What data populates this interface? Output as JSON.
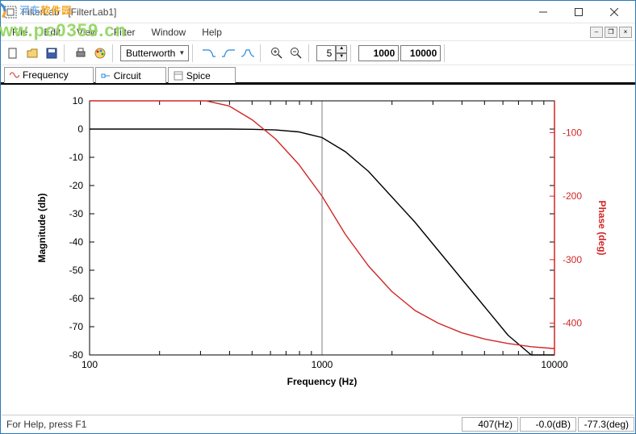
{
  "window": {
    "title": "FilterLab - [FilterLab1]"
  },
  "menu": [
    "File",
    "Edit",
    "View",
    "Filter",
    "Window",
    "Help"
  ],
  "toolbar": {
    "filter_type": "Butterworth",
    "order": "5",
    "freq1": "1000",
    "freq2": "10000"
  },
  "tabs": [
    "Frequency",
    "Circuit",
    "Spice"
  ],
  "active_tab": 0,
  "status": {
    "help": "For Help, press F1",
    "freq": "407(Hz)",
    "mag": "-0.0(dB)",
    "phase": "-77.3(deg)"
  },
  "watermark": {
    "line1a": "河东",
    "line1b": "软件园",
    "line2": "www.pc0359.cn"
  },
  "chart_data": {
    "type": "line",
    "title": "",
    "xlabel": "Frequency (Hz)",
    "ylabel_left": "Magnitude (db)",
    "ylabel_right": "Phase (deg)",
    "x": [
      100,
      126,
      158,
      200,
      251,
      316,
      398,
      501,
      631,
      794,
      1000,
      1259,
      1585,
      1995,
      2512,
      3162,
      3981,
      5012,
      6310,
      7943,
      10000
    ],
    "series": [
      {
        "name": "Magnitude",
        "axis": "left",
        "color": "#000000",
        "values": [
          0,
          0,
          0,
          0,
          0,
          0,
          0,
          -0.1,
          -0.3,
          -1,
          -3,
          -8,
          -15,
          -24,
          -33,
          -43,
          -53,
          -63,
          -73,
          -80,
          -80
        ]
      },
      {
        "name": "Phase",
        "axis": "right",
        "color": "#d22626",
        "values": [
          -5,
          -10,
          -15,
          -22,
          -30,
          -42,
          -58,
          -80,
          -110,
          -150,
          -200,
          -260,
          -310,
          -350,
          -380,
          -400,
          -415,
          -425,
          -432,
          -437,
          -440
        ]
      }
    ],
    "x_scale": "log",
    "xlim": [
      100,
      10000
    ],
    "ylim_left": [
      -80,
      10
    ],
    "ylim_right": [
      -450,
      -50
    ],
    "yticks_left": [
      -80,
      -70,
      -60,
      -50,
      -40,
      -30,
      -20,
      -10,
      0,
      10
    ],
    "yticks_right": [
      -400,
      -300,
      -200,
      -100
    ],
    "xticks": [
      100,
      1000,
      10000
    ]
  }
}
